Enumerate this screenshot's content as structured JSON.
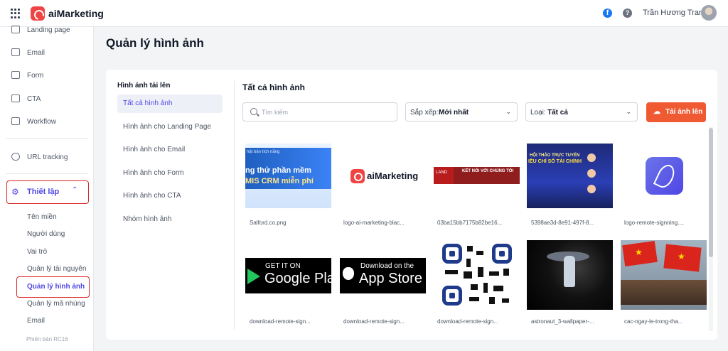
{
  "app": {
    "brand": "aiMarketing",
    "user_name": "Trần Hương Trang"
  },
  "sidebar": {
    "items": [
      {
        "label": "Landing page",
        "icon": "landing-page-icon"
      },
      {
        "label": "Email",
        "icon": "email-icon"
      },
      {
        "label": "Form",
        "icon": "form-icon"
      },
      {
        "label": "CTA",
        "icon": "cta-icon"
      },
      {
        "label": "Workflow",
        "icon": "workflow-icon"
      },
      {
        "label": "URL tracking",
        "icon": "link-icon"
      }
    ],
    "settings": {
      "label": "Thiết lập",
      "icon": "gear-icon",
      "expanded": true
    },
    "sub_items": [
      {
        "label": "Tên miền"
      },
      {
        "label": "Người dùng"
      },
      {
        "label": "Vai trò"
      },
      {
        "label": "Quản lý tài nguyên"
      },
      {
        "label": "Quản lý hình ảnh",
        "active": true
      },
      {
        "label": "Quản lý mã nhúng"
      },
      {
        "label": "Email"
      }
    ],
    "version": "Phiên bản RC16"
  },
  "page": {
    "title": "Quản lý hình ảnh"
  },
  "categories": {
    "heading": "Hình ảnh tải lên",
    "items": [
      {
        "label": "Tất cả hình ảnh",
        "active": true
      },
      {
        "label": "Hình ảnh cho Landing Page"
      },
      {
        "label": "Hình ảnh cho Email"
      },
      {
        "label": "Hình ảnh cho Form"
      },
      {
        "label": "Hình ảnh cho CTA"
      },
      {
        "label": "Nhóm hình ảnh"
      }
    ]
  },
  "content": {
    "title": "Tất cả hình ảnh",
    "search_placeholder": "Tìm kiếm",
    "sort_prefix": "Sắp xếp:",
    "sort_value": "Mới nhất",
    "type_prefix": "Loại:",
    "type_value": "Tất cả",
    "upload_label": "Tải ảnh lên",
    "images": [
      {
        "name": "Salford.co.png",
        "thumb_text": [
          "hật bản tích năng",
          "ng thử phần mềm",
          "MIS CRM miễn phí"
        ]
      },
      {
        "name": "logo-ai-marketing-blac...",
        "thumb_text": [
          "aiMarketing"
        ]
      },
      {
        "name": "03ba15bb7175b82be16...",
        "thumb_text": [
          "LAND",
          "KẾT NỐI VỚI CHÚNG TÔI"
        ]
      },
      {
        "name": "5398ae3d-8e91-497f-8...",
        "thumb_text": [
          "HỘI THẢO TRỰC TUYẾN",
          "IỀU CHỈ SỐ TÀI CHÍNH"
        ]
      },
      {
        "name": "logo-remote-signning....",
        "thumb_text": []
      },
      {
        "name": "download-remote-sign...",
        "thumb_text": [
          "GET IT ON",
          "Google Play"
        ]
      },
      {
        "name": "download-remote-sign...",
        "thumb_text": [
          "Download on the",
          "App Store"
        ]
      },
      {
        "name": "download-remote-sign...",
        "thumb_text": []
      },
      {
        "name": "astronaut_3-wallpaper-...",
        "thumb_text": []
      },
      {
        "name": "cac-ngay-le-trong-tha...",
        "thumb_text": []
      }
    ]
  },
  "colors": {
    "accent": "#4f46e5",
    "upload_button": "#f05a33",
    "highlight_border": "#dc2626"
  }
}
